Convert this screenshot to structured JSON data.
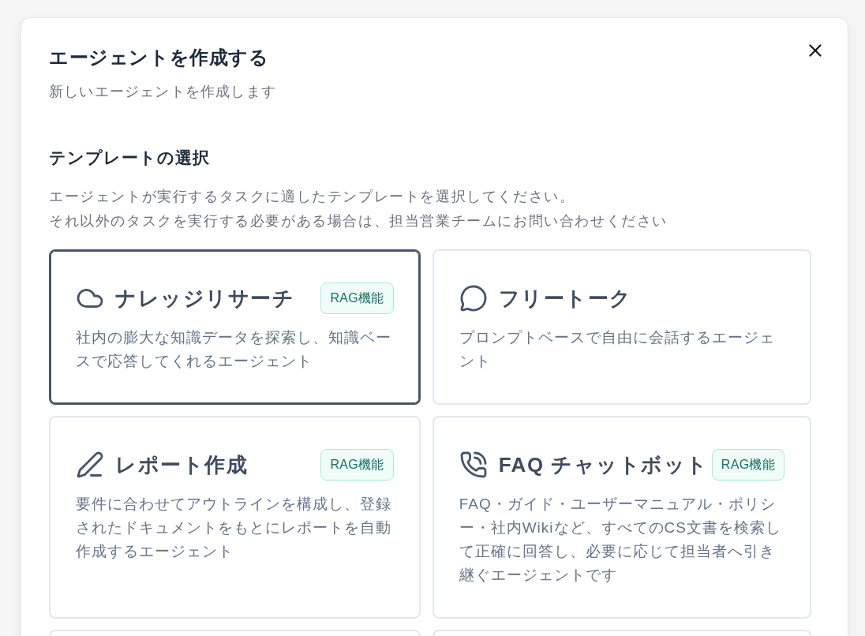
{
  "dialog": {
    "title": "エージェントを作成する",
    "subtitle": "新しいエージェントを作成します"
  },
  "template_section": {
    "heading": "テンプレートの選択",
    "description_lines": [
      "エージェントが実行するタスクに適したテンプレートを選択してください。",
      "それ以外のタスクを実行する必要がある場合は、担当営業チームにお問い合わせください"
    ]
  },
  "templates": [
    {
      "kind": "research",
      "title": "ナレッジリサーチ",
      "badge": "RAG機能",
      "description": "社内の膨大な知識データを探索し、知識ベースで応答してくれるエージェント",
      "selected": true
    },
    {
      "kind": "talk",
      "title": "フリートーク",
      "description": "プロンプトベースで自由に会話するエージェント",
      "selected": false
    },
    {
      "kind": "report",
      "title": "レポート作成",
      "badge": "RAG機能",
      "description": "要件に合わせてアウトラインを構成し、登録されたドキュメントをもとにレポートを自動作成するエージェント",
      "selected": false
    },
    {
      "kind": "faq",
      "title": "FAQ チャットボット",
      "badge": "RAG機能",
      "description": "FAQ・ガイド・ユーザーマニュアル・ポリシー・社内Wikiなど、すべてのCS文書を検索して正確に回答し、必要に応じて担当者へ引き継ぐエージェントです",
      "selected": false
    },
    {
      "selected": false
    },
    {
      "selected": false
    }
  ]
}
